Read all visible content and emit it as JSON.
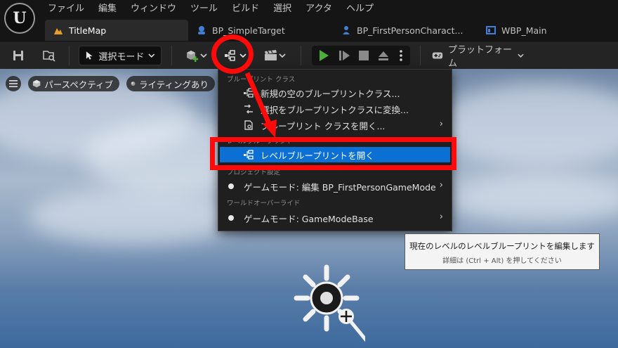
{
  "logo": "U",
  "menu": [
    "ファイル",
    "編集",
    "ウィンドウ",
    "ツール",
    "ビルド",
    "選択",
    "アクタ",
    "ヘルプ"
  ],
  "tabs": [
    {
      "label": "TitleMap",
      "icon": "level-icon",
      "active": true
    },
    {
      "label": "BP_SimpleTarget",
      "icon": "blueprint-actor-icon",
      "active": false
    },
    {
      "label": "BP_FirstPersonCharact...",
      "icon": "blueprint-character-icon",
      "active": false
    },
    {
      "label": "WBP_Main",
      "icon": "widget-blueprint-icon",
      "active": false
    }
  ],
  "toolbar": {
    "mode_label": "選択モード",
    "platform_label": "プラットフォーム"
  },
  "viewport": {
    "perspective_label": "パースペクティブ",
    "lighting_label": "ライティングあり"
  },
  "dropdown": {
    "section_blueprint_class": "ブループリント クラス",
    "new_empty_class": "新規の空のブループリントクラス...",
    "convert_selection": "選択をブループリントクラスに変換...",
    "open_blueprint_class": "ブループリント クラスを開く...",
    "section_level_blueprint": "レベルブループリント",
    "open_level_blueprint": "レベルブループリントを開く",
    "section_project_settings": "プロジェクト設定",
    "game_mode_edit": "ゲームモード: 編集 BP_FirstPersonGameMode",
    "section_world_override": "ワールドオーバーライド",
    "game_mode_base": "ゲームモード: GameModeBase"
  },
  "tooltip": {
    "main": "現在のレベルのレベルブループリントを編集します",
    "sub": "詳細は (Ctrl + Alt) を押してください"
  },
  "colors": {
    "highlight": "#0b6fd4",
    "annotation": "#ff0a0a",
    "play_green": "#4caf3a"
  }
}
